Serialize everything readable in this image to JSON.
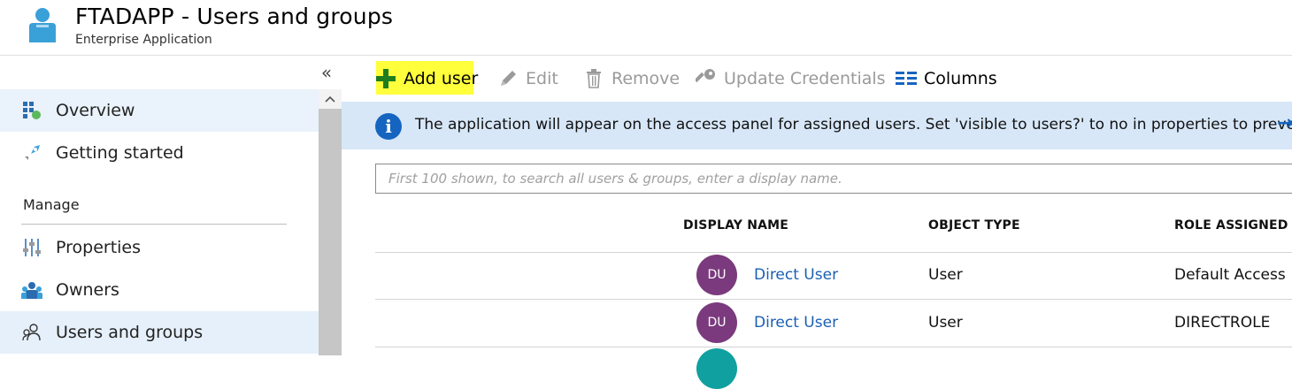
{
  "header": {
    "title": "FTADAPP - Users and groups",
    "subtitle": "Enterprise Application",
    "icon": "enterprise-app-user-icon",
    "icon_color": "#3aa0d8"
  },
  "sidebar": {
    "collapse_glyph": "«",
    "scroll_up_glyph": "^",
    "items": [
      {
        "label": "Overview",
        "icon": "overview-grid-icon",
        "state": "active"
      },
      {
        "label": "Getting started",
        "icon": "rocket-icon",
        "state": "normal"
      }
    ],
    "section": "Manage",
    "manage_items": [
      {
        "label": "Properties",
        "icon": "properties-sliders-icon",
        "state": "normal"
      },
      {
        "label": "Owners",
        "icon": "owners-icon",
        "state": "normal"
      },
      {
        "label": "Users and groups",
        "icon": "users-groups-icon",
        "state": "selected"
      }
    ]
  },
  "toolbar": {
    "add_user": "Add user",
    "edit": "Edit",
    "remove": "Remove",
    "update_credentials": "Update Credentials",
    "columns": "Columns",
    "highlight_color": "#ffff3c"
  },
  "info_bar": {
    "text": "The application will appear on the access panel for assigned users. Set 'visible to users?' to no in properties to prevent this.",
    "arrow": "→",
    "icon": "info-icon"
  },
  "search": {
    "placeholder": "First 100 shown, to search all users & groups, enter a display name."
  },
  "table": {
    "columns": [
      "DISPLAY NAME",
      "OBJECT TYPE",
      "ROLE ASSIGNED"
    ],
    "rows": [
      {
        "initials": "DU",
        "name": "Direct User",
        "type": "User",
        "role": "Default Access"
      },
      {
        "initials": "DU",
        "name": "Direct User",
        "type": "User",
        "role": "DIRECTROLE"
      }
    ]
  },
  "colors": {
    "accent": "#1565c0",
    "avatar": "#7a3a7d",
    "info_bg": "#d7e7f8",
    "link": "#1a5fb4"
  }
}
